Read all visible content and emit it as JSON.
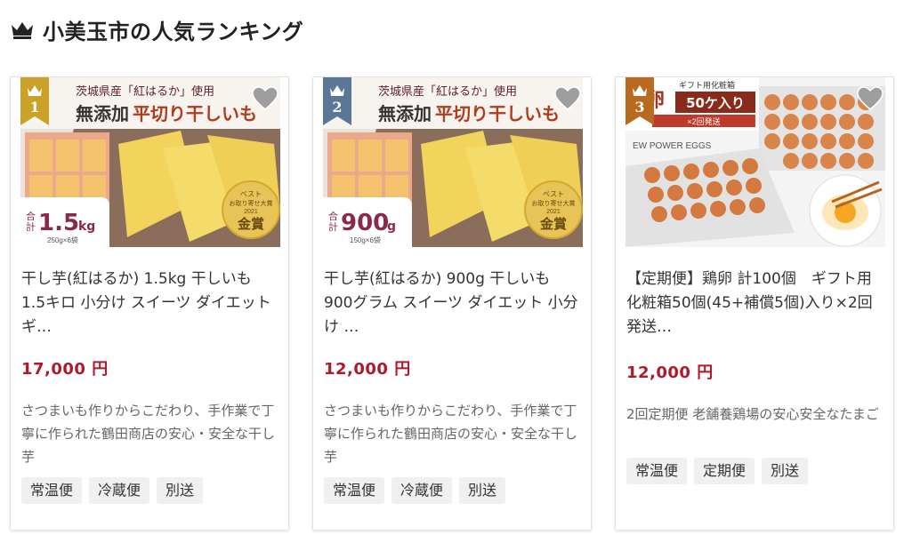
{
  "header": {
    "title": "小美玉市の人気ランキング"
  },
  "cards": [
    {
      "rank": "1",
      "image_text": {
        "top": "茨城県産「紅はるか」使用",
        "main_a": "無添加",
        "main_b": "平切り干しいも",
        "total_label_a": "合",
        "total_label_b": "計",
        "amount": "1.5",
        "unit": "kg",
        "sub": "250g×6袋",
        "award_a": "ベスト",
        "award_b": "お取り寄せ大賞",
        "award_c": "2021",
        "award_d": "金賞"
      },
      "title": "干し芋(紅はるか) 1.5kg 干しいも 1.5キロ 小分け スイーツ ダイエット ギ…",
      "price": "17,000 円",
      "desc": "さつまいも作りからこだわり、手作業で丁寧に作られた鶴田商店の安心・安全な干し芋",
      "tags": [
        "常温便",
        "冷蔵便",
        "別送"
      ]
    },
    {
      "rank": "2",
      "image_text": {
        "top": "茨城県産「紅はるか」使用",
        "main_a": "無添加",
        "main_b": "平切り干しいも",
        "total_label_a": "合",
        "total_label_b": "計",
        "amount": "900",
        "unit": "g",
        "sub": "150g×6袋",
        "award_a": "ベスト",
        "award_b": "お取り寄せ大賞",
        "award_c": "2021",
        "award_d": "金賞"
      },
      "title": "干し芋(紅はるか) 900g 干しいも 900グラム スイーツ ダイエット 小分け …",
      "price": "12,000 円",
      "desc": "さつまいも作りからこだわり、手作業で丁寧に作られた鶴田商店の安心・安全な干し芋",
      "tags": [
        "常温便",
        "冷蔵便",
        "別送"
      ]
    },
    {
      "rank": "3",
      "image_text": {
        "brand": "鶏卵",
        "gift": "ギフト用化粧箱",
        "count": "50ケ入り",
        "ship": "×2回発送",
        "eggs": "EW POWER EGGS"
      },
      "title": "【定期便】鶏卵 計100個　ギフト用化粧箱50個(45+補償5個)入り×2回発送…",
      "price": "12,000 円",
      "desc": "2回定期便 老舗養鶏場の安心安全なたまご",
      "tags": [
        "常温便",
        "定期便",
        "別送"
      ]
    }
  ],
  "colors": {
    "price": "#b0192c",
    "rank1": "#c9a227",
    "rank2": "#5a7896",
    "rank3": "#b86a1e"
  }
}
